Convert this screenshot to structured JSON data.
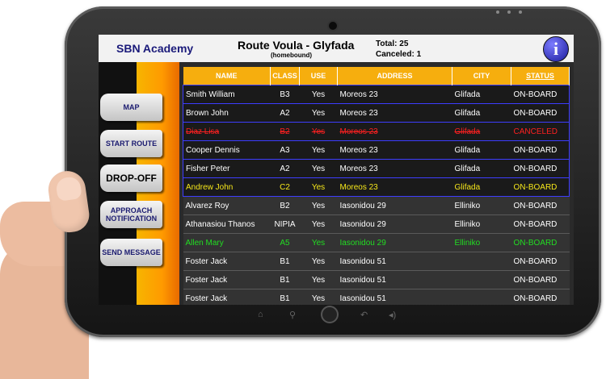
{
  "header": {
    "brand": "SBN Academy",
    "route_title": "Route Voula - Glyfada",
    "route_subtitle": "(homebound)",
    "total_label": "Total:",
    "total_value": "25",
    "canceled_label": "Canceled:",
    "canceled_value": "1",
    "info_icon": "i"
  },
  "sidebar": {
    "items": [
      {
        "label": "MAP"
      },
      {
        "label": "START ROUTE"
      },
      {
        "label": "DROP-OFF"
      },
      {
        "label": "APPROACH NOTIFICATION"
      },
      {
        "label": "SEND MESSAGE"
      }
    ]
  },
  "table": {
    "columns": [
      "NAME",
      "CLASS",
      "USE",
      "ADDRESS",
      "CITY",
      "STATUS"
    ],
    "rows": [
      {
        "name": "Smith William",
        "class": "B3",
        "use": "Yes",
        "address": "Moreos 23",
        "city": "Glifada",
        "status": "ON-BOARD"
      },
      {
        "name": "Brown John",
        "class": "A2",
        "use": "Yes",
        "address": "Moreos 23",
        "city": "Glifada",
        "status": "ON-BOARD"
      },
      {
        "name": "Diaz Lisa",
        "class": "B2",
        "use": "Yes",
        "address": "Moreos 23",
        "city": "Glifada",
        "status": "CANCELED"
      },
      {
        "name": "Cooper Dennis",
        "class": "A3",
        "use": "Yes",
        "address": "Moreos 23",
        "city": "Glifada",
        "status": "ON-BOARD"
      },
      {
        "name": "Fisher Peter",
        "class": "A2",
        "use": "Yes",
        "address": "Moreos 23",
        "city": "Glifada",
        "status": "ON-BOARD"
      },
      {
        "name": "Andrew John",
        "class": "C2",
        "use": "Yes",
        "address": "Moreos 23",
        "city": "Glifada",
        "status": "ON-BOARD"
      },
      {
        "name": "Alvarez Roy",
        "class": "B2",
        "use": "Yes",
        "address": "Iasonidou 29",
        "city": "Elliniko",
        "status": "ON-BOARD"
      },
      {
        "name": "Athanasiou Thanos",
        "class": "NIPIA",
        "use": "Yes",
        "address": "Iasonidou 29",
        "city": "Elliniko",
        "status": "ON-BOARD"
      },
      {
        "name": "Allen Mary",
        "class": "A5",
        "use": "Yes",
        "address": "Iasonidou 29",
        "city": "Elliniko",
        "status": "ON-BOARD"
      },
      {
        "name": "Foster Jack",
        "class": "B1",
        "use": "Yes",
        "address": "Iasonidou 51",
        "city": "",
        "status": "ON-BOARD"
      },
      {
        "name": "Foster Jack",
        "class": "B1",
        "use": "Yes",
        "address": "Iasonidou 51",
        "city": "",
        "status": "ON-BOARD"
      },
      {
        "name": "Foster Jack",
        "class": "B1",
        "use": "Yes",
        "address": "Iasonidou 51",
        "city": "",
        "status": "ON-BOARD"
      }
    ]
  },
  "device": {
    "nav_icons": [
      "home-icon",
      "search-icon",
      "home-key",
      "back-icon",
      "volume-icon"
    ]
  },
  "colors": {
    "header_orange": "#f6ae0e",
    "canceled_red": "#ff2020",
    "highlight_yellow": "#f6e71a",
    "highlight_green": "#22dd22",
    "selection_blue": "#3d3dff"
  }
}
